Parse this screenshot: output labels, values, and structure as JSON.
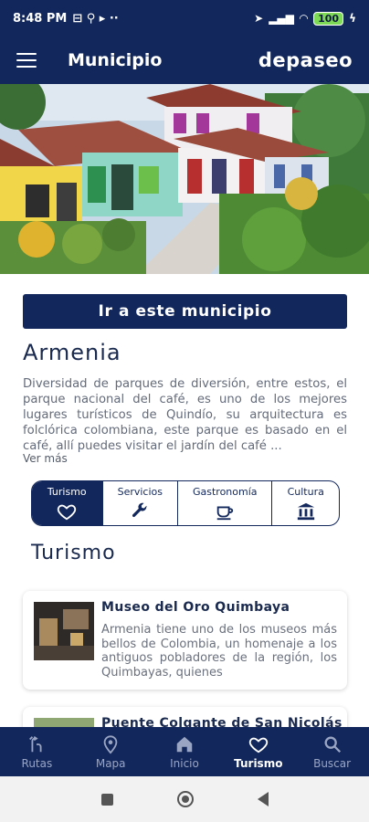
{
  "status_bar": {
    "time": "8:48 PM",
    "battery": "100"
  },
  "app_bar": {
    "title": "Municipio",
    "brand": "depaseo"
  },
  "cta_label": "Ir a este municipio",
  "municipio": {
    "name": "Armenia",
    "description": "Diversidad de parques de diversión, entre estos, el parque nacional del café, es uno de los mejores lugares turísticos de Quindío, su arquitectura es folclórica colombiana, este parque es basado en el café, allí puedes visitar el jardín del café ...",
    "more_label": "Ver más"
  },
  "tabs": [
    {
      "label": "Turismo",
      "icon": "heart-icon",
      "active": true
    },
    {
      "label": "Servicios",
      "icon": "wrench-icon",
      "active": false
    },
    {
      "label": "Gastronomía",
      "icon": "coffee-cup-icon",
      "active": false
    },
    {
      "label": "Cultura",
      "icon": "museum-icon",
      "active": false
    }
  ],
  "section_title": "Turismo",
  "places": [
    {
      "title": "Museo del Oro Quimbaya",
      "text": "Armenia tiene uno de los museos más bellos de Colombia, un homenaje a los antiguos pobladores de la región, los Quimbayas, quienes"
    },
    {
      "title": "Puente Colgante de San Nicolás",
      "text": ""
    }
  ],
  "bottom_nav": [
    {
      "label": "Rutas",
      "icon": "routes-icon",
      "active": false
    },
    {
      "label": "Mapa",
      "icon": "map-pin-icon",
      "active": false
    },
    {
      "label": "Inicio",
      "icon": "home-icon",
      "active": false
    },
    {
      "label": "Turismo",
      "icon": "heart-icon",
      "active": true
    },
    {
      "label": "Buscar",
      "icon": "search-icon",
      "active": false
    }
  ],
  "colors": {
    "primary": "#12275b",
    "active_nav": "#ffffff",
    "inactive_nav": "#9aa5c4"
  }
}
